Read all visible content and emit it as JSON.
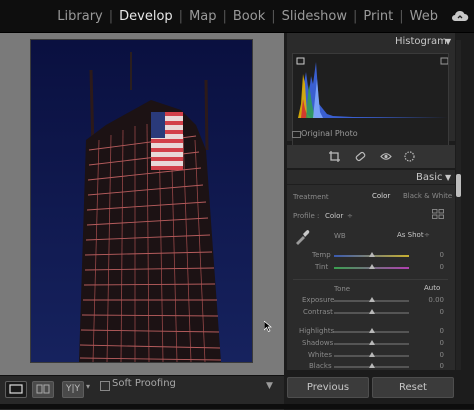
{
  "modules": [
    {
      "label": "Library",
      "active": false
    },
    {
      "label": "Develop",
      "active": true
    },
    {
      "label": "Map",
      "active": false
    },
    {
      "label": "Book",
      "active": false
    },
    {
      "label": "Slideshow",
      "active": false
    },
    {
      "label": "Print",
      "active": false
    },
    {
      "label": "Web",
      "active": false
    }
  ],
  "toolbar": {
    "view_modes": [
      "loupe-view",
      "before-after-lr",
      "before-after-tb"
    ],
    "yy_label": "Y|Y",
    "soft_proofing": "Soft Proofing",
    "soft_proofing_checked": false
  },
  "histogram": {
    "title": "Histogram",
    "original_photo": "Original Photo"
  },
  "tools": [
    "crop-icon",
    "spot-removal-icon",
    "red-eye-icon",
    "masking-icon"
  ],
  "basic": {
    "title": "Basic",
    "treatment_label": "Treatment",
    "treatment_color": "Color",
    "treatment_bw": "Black & White",
    "profile_label": "Profile :",
    "profile_value": "Color",
    "wb_label": "WB",
    "wb_value": "As Shot",
    "temp_label": "Temp",
    "temp_value": "0",
    "tint_label": "Tint",
    "tint_value": "0",
    "tone_label": "Tone",
    "auto_label": "Auto",
    "exposure_label": "Exposure",
    "exposure_value": "0.00",
    "contrast_label": "Contrast",
    "contrast_value": "0",
    "highlights_label": "Highlights",
    "highlights_value": "0",
    "shadows_label": "Shadows",
    "shadows_value": "0",
    "whites_label": "Whites",
    "whites_value": "0",
    "blacks_label": "Blacks",
    "blacks_value": "0"
  },
  "buttons": {
    "previous": "Previous",
    "reset": "Reset"
  },
  "colors": {
    "active_module": "#e8e8e8",
    "inactive_module": "#9a9a9a",
    "panel": "#2b2b2b"
  }
}
